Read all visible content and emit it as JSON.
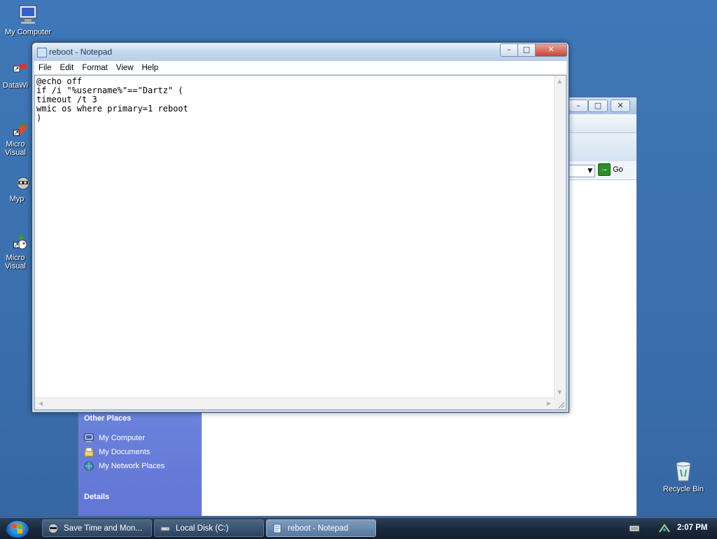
{
  "desktop": {
    "icons": [
      {
        "label": "My Computer"
      },
      {
        "label": "DataWi"
      },
      {
        "label": "Micro Visual"
      },
      {
        "label": "Myp"
      },
      {
        "label": "Micro Visual"
      }
    ],
    "recycle_bin": {
      "label": "Recycle Bin"
    }
  },
  "notepad": {
    "title": "reboot - Notepad",
    "menu": [
      "File",
      "Edit",
      "Format",
      "View",
      "Help"
    ],
    "content": "@echo off\nif /i \"%username%\"==\"Dartz\" (\ntimeout /t 3\nwmic os where primary=1 reboot\n)",
    "buttons": {
      "minimize": "–",
      "maximize": "□",
      "close": "✕"
    }
  },
  "explorer": {
    "go_label": "Go",
    "other_places": {
      "heading": "Other Places",
      "items": [
        {
          "label": "My Computer"
        },
        {
          "label": "My Documents"
        },
        {
          "label": "My Network Places"
        }
      ]
    },
    "details_heading": "Details"
  },
  "taskbar": {
    "tasks": [
      {
        "label": "Save Time and Mon..."
      },
      {
        "label": "Local Disk (C:)"
      },
      {
        "label": "reboot - Notepad",
        "active": true
      }
    ],
    "clock": "2:07 PM"
  }
}
